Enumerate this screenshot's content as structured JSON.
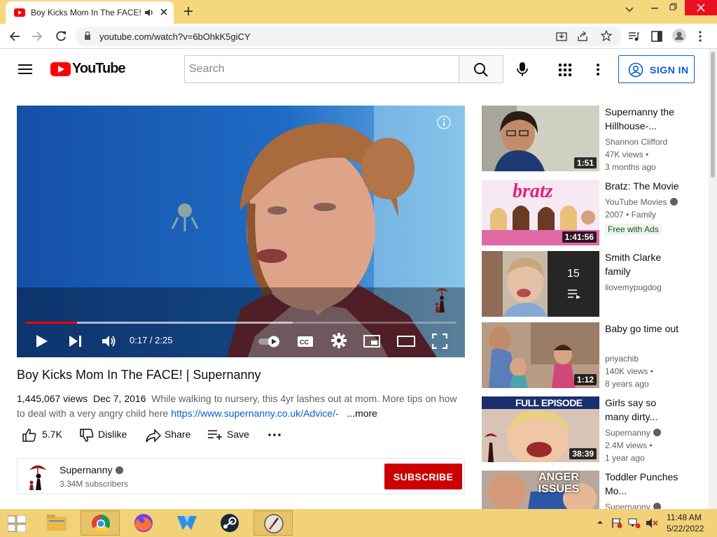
{
  "browser": {
    "tab_title": "Boy Kicks Mom In The FACE! | Supernanny - YouTube",
    "url": "youtube.com/watch?v=6bOhkK5giCY"
  },
  "masthead": {
    "logo_text": "YouTube",
    "search_placeholder": "Search",
    "sign_in_label": "SIGN IN"
  },
  "player": {
    "time": "0:17 / 2:25",
    "played_fraction": 0.12,
    "buffered_fraction": 0.62
  },
  "video": {
    "title": "Boy Kicks Mom In The FACE! | Supernanny",
    "views": "1,445,067 views",
    "date": "Dec 7, 2016",
    "description": "While walking to nursery, this 4yr lashes out at mom. More tips on how to deal with a very angry child here",
    "link": "https://www.supernanny.co.uk/Advice/-",
    "more": "...more",
    "likes": "5.7K",
    "dislike_label": "Dislike",
    "share_label": "Share",
    "save_label": "Save"
  },
  "channel": {
    "name": "Supernanny",
    "subscribers": "3.34M subscribers",
    "subscribe_label": "SUBSCRIBE"
  },
  "recommendations": [
    {
      "title": "Supernanny the Hillhouse-...",
      "channel": "Shannon Clifford",
      "meta1": "47K views •",
      "meta2": "3 months ago",
      "duration": "1:51"
    },
    {
      "title": "Bratz: The Movie",
      "channel": "YouTube Movies",
      "meta1": "2007 • Family",
      "badge": "Free with Ads",
      "duration": "1:41:56",
      "thumb_text": "bratz"
    },
    {
      "title": "Smith Clarke family",
      "channel": "ilovemypugdog",
      "playlist_count": "15"
    },
    {
      "title": "Baby go time out",
      "channel": "priyachib",
      "meta1": "140K views •",
      "meta2": "8 years ago",
      "duration": "1:12"
    },
    {
      "title": "Girls say so many dirty...",
      "channel": "Supernanny",
      "meta1": "2.4M views •",
      "meta2": "1 year ago",
      "duration": "38:39",
      "thumb_text": "FULL EPISODE"
    },
    {
      "title": "Toddler Punches Mo...",
      "channel": "Supernanny",
      "thumb_text": "ANGER ISSUES"
    }
  ],
  "taskbar": {
    "time": "11:48 AM",
    "date": "5/22/2022"
  },
  "colors": {
    "tab_strip": "#f5d77e",
    "youtube_red": "#ff0000",
    "subscribe_red": "#cc0000",
    "link_blue": "#065fd4",
    "taskbar": "#f2d278"
  }
}
